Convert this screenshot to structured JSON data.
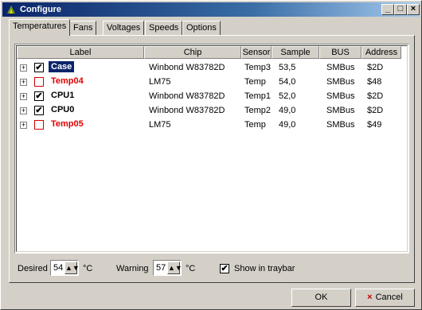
{
  "window": {
    "title": "Configure",
    "minimize": "_",
    "maximize": "□",
    "close": "×"
  },
  "tabs": [
    {
      "label": "Temperatures"
    },
    {
      "label": "Fans"
    },
    {
      "label": "Voltages"
    },
    {
      "label": "Speeds"
    },
    {
      "label": "Options"
    }
  ],
  "columns": {
    "label": "Label",
    "chip": "Chip",
    "sensor": "Sensor",
    "sample": "Sample",
    "bus": "BUS",
    "address": "Address"
  },
  "rows": [
    {
      "expander": "+",
      "checked": true,
      "check_mark": "✔",
      "label": "Case",
      "chip": "Winbond W83782D",
      "sensor": "Temp3",
      "sample": "53,5",
      "bus": "SMBus",
      "address": "$2D",
      "color": "#000000",
      "selected": true
    },
    {
      "expander": "+",
      "checked": false,
      "check_mark": "",
      "label": "Temp04",
      "chip": "LM75",
      "sensor": "Temp",
      "sample": "54,0",
      "bus": "SMBus",
      "address": "$48",
      "color": "#e00000",
      "selected": false
    },
    {
      "expander": "+",
      "checked": true,
      "check_mark": "✔",
      "label": "CPU1",
      "chip": "Winbond W83782D",
      "sensor": "Temp1",
      "sample": "52,0",
      "bus": "SMBus",
      "address": "$2D",
      "color": "#000000",
      "selected": false
    },
    {
      "expander": "+",
      "checked": true,
      "check_mark": "✔",
      "label": "CPU0",
      "chip": "Winbond W83782D",
      "sensor": "Temp2",
      "sample": "49,0",
      "bus": "SMBus",
      "address": "$2D",
      "color": "#000000",
      "selected": false
    },
    {
      "expander": "+",
      "checked": false,
      "check_mark": "",
      "label": "Temp05",
      "chip": "LM75",
      "sensor": "Temp",
      "sample": "49,0",
      "bus": "SMBus",
      "address": "$49",
      "color": "#e00000",
      "selected": false
    }
  ],
  "bottom": {
    "desired_label": "Desired",
    "desired_value": "54",
    "desired_unit": "°C",
    "warning_label": "Warning",
    "warning_value": "57",
    "warning_unit": "°C",
    "traybar_checked": true,
    "traybar_mark": "✔",
    "traybar_label": "Show in traybar",
    "spin_glyph": "▲▼"
  },
  "buttons": {
    "ok": "OK",
    "cancel": "Cancel",
    "cancel_icon": "×"
  },
  "colors": {
    "title_start": "#0a246a",
    "selection": "#0a246a",
    "disabled_red": "#e00000"
  }
}
